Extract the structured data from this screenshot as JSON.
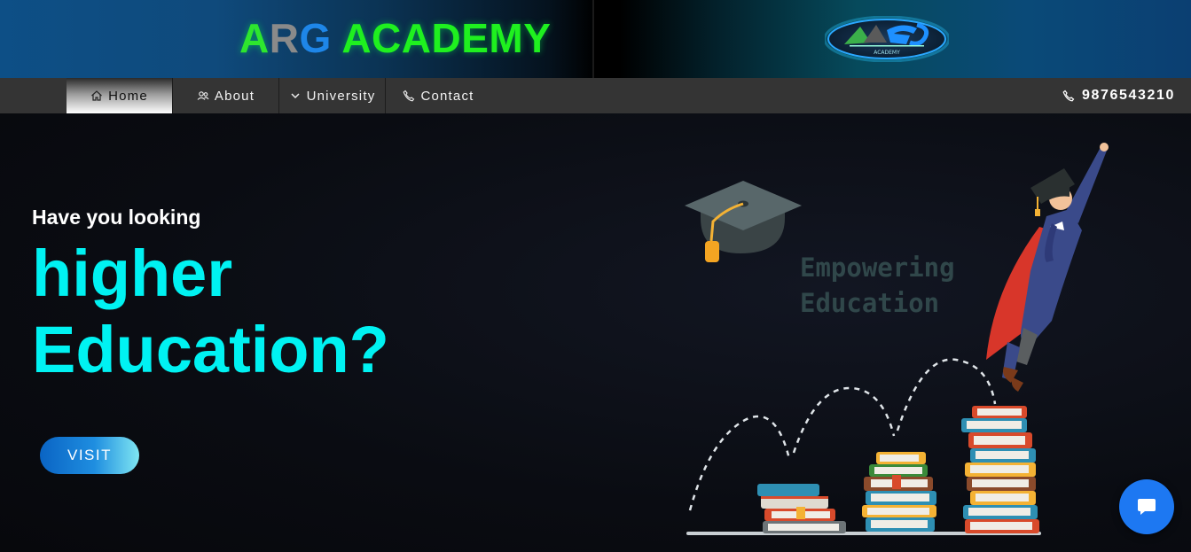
{
  "header": {
    "brand_a": "A",
    "brand_r": "R",
    "brand_g": "G",
    "brand_rest": " ACADEMY",
    "logo_icon": "arg-academy-logo"
  },
  "nav": {
    "items": [
      {
        "label": "Home",
        "icon": "home-icon"
      },
      {
        "label": "About",
        "icon": "users-icon"
      },
      {
        "label": "University",
        "icon": "chevron-down-icon"
      },
      {
        "label": "Contact",
        "icon": "phone-icon"
      }
    ],
    "phone": "9876543210",
    "active": "Home"
  },
  "hero": {
    "subtitle": "Have you looking",
    "title_line1": "higher",
    "title_line2": "Education?",
    "button_label": "VISIT",
    "illustration_text_1": "Empowering",
    "illustration_text_2": "Education"
  },
  "chat": {
    "icon": "chat-bubble-icon"
  },
  "colors": {
    "accent_cyan": "#00f2f2",
    "brand_green": "#1ff01f",
    "button_blue": "#1f8ee0",
    "chat_blue": "#1d78f2",
    "nav_bg": "#343434"
  }
}
